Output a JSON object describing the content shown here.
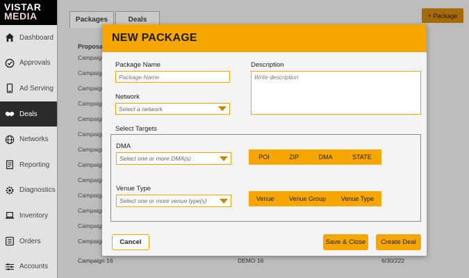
{
  "brand": {
    "line1": "VISTAR",
    "line2": "MEDIA"
  },
  "sidebar": {
    "items": [
      {
        "label": "Dashboard",
        "icon": "home-icon"
      },
      {
        "label": "Approvals",
        "icon": "check-circle-icon"
      },
      {
        "label": "Ad Serving",
        "icon": "tablet-icon"
      },
      {
        "label": "Deals",
        "icon": "handshake-icon",
        "active": true
      },
      {
        "label": "Networks",
        "icon": "globe-icon"
      },
      {
        "label": "Reporting",
        "icon": "report-icon"
      },
      {
        "label": "Diagnostics",
        "icon": "gear-icon"
      },
      {
        "label": "Inventory",
        "icon": "laptop-icon"
      },
      {
        "label": "Orders",
        "icon": "list-icon"
      },
      {
        "label": "Accounts",
        "icon": "sliders-icon"
      }
    ]
  },
  "background": {
    "tabs": [
      "Packages",
      "Deals"
    ],
    "add_button": "+ Package",
    "column_header": "Proposal",
    "rows": [
      "Campaign",
      "Campaign",
      "Campaign",
      "Campaign",
      "Campaign",
      "Campaign",
      "Campaign",
      "Campaign",
      "Campaign",
      "Campaign",
      "Campaign",
      "Campaign",
      "Campaign"
    ],
    "last_row": {
      "name": "Campaign 16",
      "demo": "DEMO 16",
      "date": "6/30/222"
    }
  },
  "modal": {
    "title": "NEW PACKAGE",
    "package_name": {
      "label": "Package Name",
      "placeholder": "Package Name"
    },
    "description": {
      "label": "Description",
      "placeholder": "Write description"
    },
    "network": {
      "label": "Network",
      "placeholder": "Select a network"
    },
    "select_targets_label": "Select Targets",
    "dma": {
      "label": "DMA",
      "placeholder": "Select one or more DMA(s)"
    },
    "venue_type": {
      "label": "Venue Type",
      "placeholder": "Select one or more venue type(s)"
    },
    "location_options": [
      "POI",
      "ZIP",
      "DMA",
      "STATE"
    ],
    "venue_options": [
      "Venue",
      "Venue Group",
      "Venue Type"
    ],
    "buttons": {
      "cancel": "Cancel",
      "save_close": "Save & Close",
      "create_deal": "Create Deal"
    }
  },
  "colors": {
    "accent": "#f6a600",
    "sidebar_active": "#2a2a2a",
    "brand_bg": "#000000"
  }
}
